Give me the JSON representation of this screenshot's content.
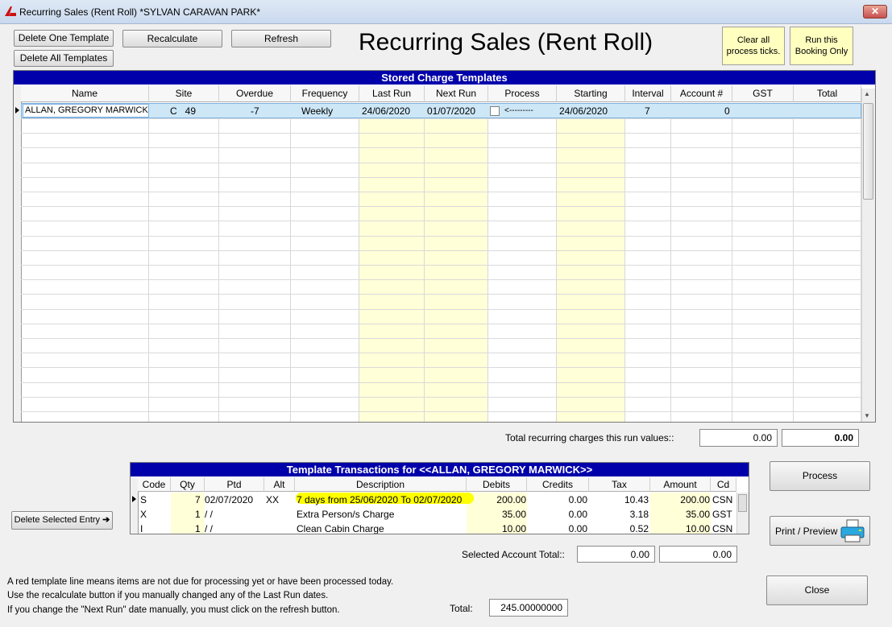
{
  "window": {
    "title": "Recurring Sales (Rent Roll)   *SYLVAN CARAVAN PARK*",
    "close_glyph": "✕"
  },
  "toolbar": {
    "delete_one": "Delete One Template",
    "delete_all": "Delete All Templates",
    "recalculate": "Recalculate",
    "refresh": "Refresh",
    "clear_ticks": "Clear all process ticks.",
    "run_booking": "Run this Booking Only"
  },
  "heading": "Recurring Sales (Rent Roll)",
  "templates": {
    "banner": "Stored Charge Templates",
    "columns": [
      "Name",
      "Site",
      "Overdue",
      "Frequency",
      "Last Run",
      "Next Run",
      "Process",
      "Starting",
      "Interval",
      "Account #",
      "GST",
      "Total"
    ],
    "rows": [
      {
        "name": "ALLAN, GREGORY MARWICK",
        "site": "C   49",
        "overdue": "-7",
        "frequency": "Weekly",
        "last_run": "24/06/2020",
        "next_run": "01/07/2020",
        "process": "<---------",
        "starting": "24/06/2020",
        "interval": "7",
        "account": "0",
        "gst": "",
        "total": ""
      }
    ]
  },
  "totals": {
    "label": "Total recurring charges this  run values::",
    "value1": "0.00",
    "value2": "0.00"
  },
  "transactions": {
    "banner": "Template Transactions for <<ALLAN, GREGORY MARWICK>>",
    "columns": [
      "Code",
      "Qty",
      "Ptd",
      "Alt",
      "Description",
      "Debits",
      "Credits",
      "Tax",
      "Amount",
      "Cd"
    ],
    "rows": [
      {
        "code": "S",
        "qty": "7",
        "ptd": "02/07/2020",
        "alt": "XX",
        "desc": "7 days from 25/06/2020 To 02/07/2020",
        "debits": "200.00",
        "credits": "0.00",
        "tax": "10.43",
        "amount": "200.00",
        "cd": "CSN"
      },
      {
        "code": "X",
        "qty": "1",
        "ptd": "/ /",
        "alt": "",
        "desc": "Extra Person/s Charge",
        "debits": "35.00",
        "credits": "0.00",
        "tax": "3.18",
        "amount": "35.00",
        "cd": "GST"
      },
      {
        "code": "I",
        "qty": "1",
        "ptd": "/ /",
        "alt": "",
        "desc": "Clean Cabin Charge",
        "debits": "10.00",
        "credits": "0.00",
        "tax": "0.52",
        "amount": "10.00",
        "cd": "CSN"
      }
    ]
  },
  "delete_entry": "Delete Selected Entry",
  "process_button": "Process",
  "print_button": "Print / Preview",
  "close_button": "Close",
  "selected_total": {
    "label": "Selected Account Total::",
    "value1": "0.00",
    "value2": "0.00"
  },
  "total": {
    "label": "Total:",
    "value": "245.00000000"
  },
  "notes": [
    "A red template line means items are not due  for processing yet or have been processed today.",
    "Use the recalculate button if you manually changed any of the Last Run dates.",
    "If you change the \"Next Run\" date manually, you must click on the refresh button."
  ],
  "colors": {
    "banner": "#0000aa",
    "highlight": "#ffff00",
    "yellow_column": "#ffffd8"
  }
}
